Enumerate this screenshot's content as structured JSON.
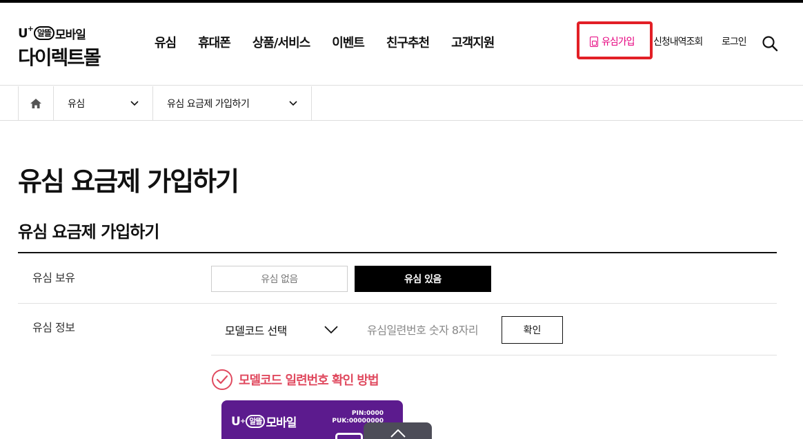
{
  "header": {
    "logo": {
      "brand_prefix": "U",
      "brand_plus": "+",
      "brand_circle": "알뜰",
      "brand_suffix": "모바일",
      "brand_main": "다이렉트몰"
    },
    "nav": [
      "유심",
      "휴대폰",
      "상품/서비스",
      "이벤트",
      "친구추천",
      "고객지원"
    ],
    "util": {
      "sim_signup": "유심가입",
      "application_lookup": "신청내역조회",
      "login": "로그인"
    },
    "accent_color": "#e6007e",
    "highlight_color": "#e21f26"
  },
  "breadcrumb": {
    "home_icon": "home-icon",
    "items": [
      "유심",
      "유심 요금제 가입하기"
    ]
  },
  "page": {
    "title": "유심 요금제 가입하기",
    "section_title": "유심 요금제 가입하기"
  },
  "form": {
    "sim_owned": {
      "label": "유심 보유",
      "options": [
        "유심 없음",
        "유심 있음"
      ],
      "selected": "유심 있음"
    },
    "sim_info": {
      "label": "유심 정보",
      "model_select_value": "모델코드 선택",
      "serial_placeholder": "유심일련번호 숫자 8자리",
      "confirm_label": "확인",
      "howto_label": "모델코드 일련번호 확인 방법"
    }
  },
  "card": {
    "brand_prefix": "U",
    "brand_plus": "+",
    "brand_circle": "알뜰",
    "brand_suffix": "모바일",
    "pin": "PIN:0000",
    "puk": "PUK:00000000",
    "color": "#5c1b8e"
  }
}
